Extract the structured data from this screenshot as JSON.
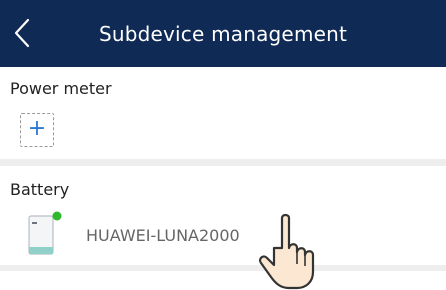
{
  "header": {
    "title": "Subdevice management",
    "background_color": "#0f2a55",
    "back_icon": "chevron-left-icon"
  },
  "sections": {
    "power_meter": {
      "label": "Power meter",
      "add_icon": "plus-icon",
      "add_symbol": "+"
    },
    "battery": {
      "label": "Battery",
      "device_icon": "battery-device-icon",
      "device_name": "HUAWEI-LUNA2000",
      "status_color": "#2eb82e"
    }
  },
  "overlay": {
    "pointer_icon": "pointing-hand-icon"
  },
  "colors": {
    "accent": "#2a79d4",
    "separator": "#eeeeee"
  }
}
